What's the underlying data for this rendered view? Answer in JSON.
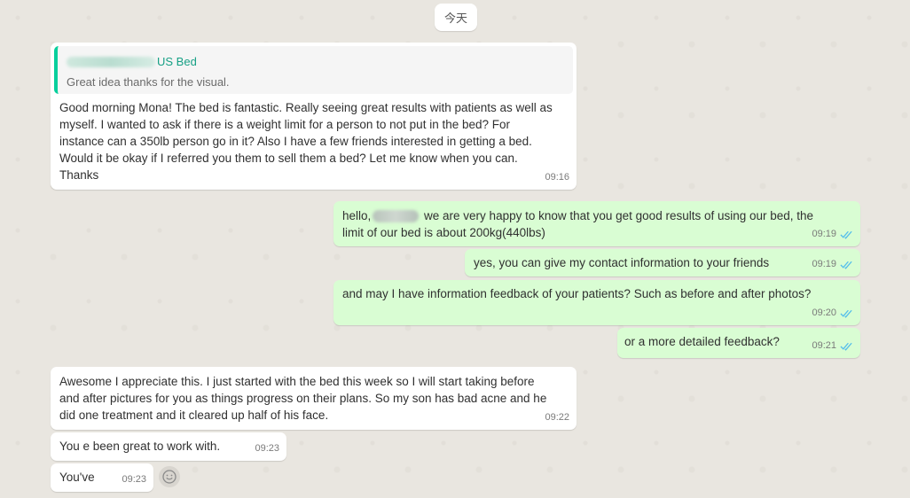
{
  "date_chip": "今天",
  "colors": {
    "incoming": "#ffffff",
    "outgoing": "#d9fdd3",
    "quote_bar": "#06cf9c",
    "ticks": "#53bdeb"
  },
  "messages": [
    {
      "quote": {
        "sender": "US Bed",
        "text": "Great idea thanks for the visual."
      },
      "lines": [
        "Good morning Mona! The bed is fantastic. Really seeing great results with patients as well as",
        "myself. I wanted to ask if there is a weight limit for a person to not put in the bed? For",
        "instance can a 350lb person go in it? Also I have a few friends interested in getting a bed.",
        "Would it be okay if I referred you them to sell them a bed? Let me know when you can.",
        "Thanks"
      ],
      "time": "09:16"
    },
    {
      "greeting": "hello,",
      "line1_rest": " we are very happy to know that you get good results of using our bed, the",
      "line2": "limit of our bed is about 200kg(440lbs)",
      "time": "09:19"
    },
    {
      "text": "yes, you can give my contact information to your friends",
      "time": "09:19"
    },
    {
      "text": "and may I have information feedback of your patients? Such as before and after photos?",
      "time": "09:20"
    },
    {
      "text": "or a more detailed feedback?",
      "time": "09:21"
    },
    {
      "lines": [
        "Awesome I appreciate this. I just started with the bed this week so I will start taking before",
        "and after pictures for you as things progress on their plans. So my son has bad acne and he",
        "did one treatment and it cleared up half of his face."
      ],
      "time": "09:22"
    },
    {
      "text": "You e been great to work with.",
      "time": "09:23"
    },
    {
      "text": "You've",
      "time": "09:23"
    }
  ]
}
